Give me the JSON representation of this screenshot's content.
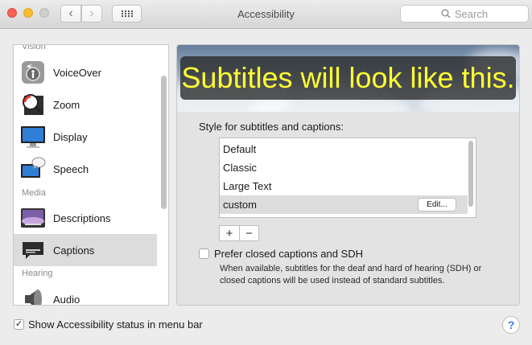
{
  "window": {
    "title": "Accessibility",
    "search_placeholder": "Search",
    "back_glyph": "‹",
    "forward_glyph": "›"
  },
  "sidebar": {
    "headers": {
      "vision": "Vision",
      "media": "Media",
      "hearing": "Hearing"
    },
    "items": [
      {
        "label": "VoiceOver",
        "icon": "voiceover-icon"
      },
      {
        "label": "Zoom",
        "icon": "zoom-icon"
      },
      {
        "label": "Display",
        "icon": "display-icon"
      },
      {
        "label": "Speech",
        "icon": "speech-icon"
      },
      {
        "label": "Descriptions",
        "icon": "descriptions-icon"
      },
      {
        "label": "Captions",
        "icon": "captions-icon",
        "selected": true
      },
      {
        "label": "Audio",
        "icon": "audio-icon"
      }
    ]
  },
  "captions": {
    "preview_text": "Subtitles will look like this.",
    "style_label": "Style for subtitles and captions:",
    "styles": [
      "Default",
      "Classic",
      "Large Text",
      "custom"
    ],
    "selected_style": "custom",
    "edit_label": "Edit...",
    "add_label": "+",
    "remove_label": "−",
    "sdh_label": "Prefer closed captions and SDH",
    "sdh_checked": false,
    "sdh_description": "When available, subtitles for the deaf and hard of hearing (SDH) or closed captions will be used instead of standard subtitles."
  },
  "footer": {
    "status_label": "Show Accessibility status in menu bar",
    "status_checked": true,
    "help_label": "?"
  },
  "colors": {
    "subtitle_text": "#ffff33",
    "close": "#fc5f57",
    "minimize": "#fdbc2e",
    "help": "#3b7be8"
  }
}
